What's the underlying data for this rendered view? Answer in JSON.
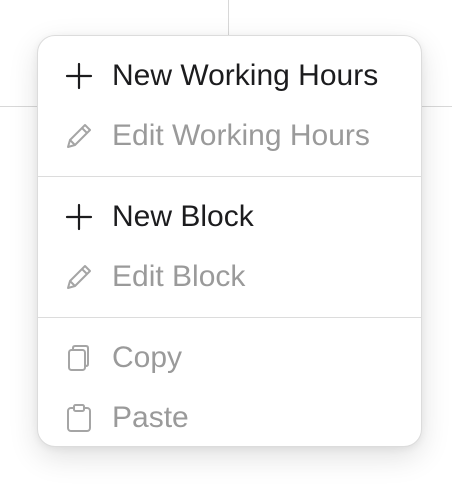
{
  "menu": {
    "items": [
      {
        "label": "New Working Hours",
        "icon": "plus-icon",
        "enabled": true
      },
      {
        "label": "Edit Working Hours",
        "icon": "pencil-icon",
        "enabled": false
      },
      {
        "label": "New Block",
        "icon": "plus-icon",
        "enabled": true
      },
      {
        "label": "Edit Block",
        "icon": "pencil-icon",
        "enabled": false
      },
      {
        "label": "Copy",
        "icon": "copy-icon",
        "enabled": false
      },
      {
        "label": "Paste",
        "icon": "clipboard-icon",
        "enabled": false
      }
    ]
  },
  "colors": {
    "enabled_text": "#1c1c1e",
    "disabled_text": "#9a9a9a",
    "separator": "#dcdcdc"
  }
}
